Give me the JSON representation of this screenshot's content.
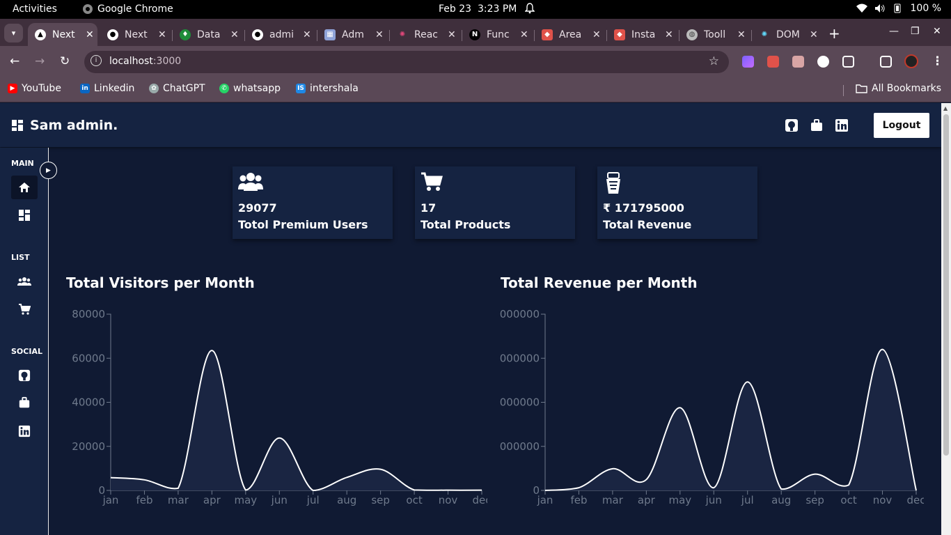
{
  "system": {
    "activities": "Activities",
    "app_name": "Google Chrome",
    "date": "Feb 23",
    "time": "3:23 PM",
    "battery": "100 %"
  },
  "browser": {
    "tabs": [
      {
        "label": "Next",
        "icon": "nextjs-icon",
        "active": true
      },
      {
        "label": "Next",
        "icon": "github-icon"
      },
      {
        "label": "Data",
        "icon": "mongodb-icon"
      },
      {
        "label": "admi",
        "icon": "github-icon"
      },
      {
        "label": "Adm",
        "icon": "dashboard-icon"
      },
      {
        "label": "Reac",
        "icon": "react-icon"
      },
      {
        "label": "Func",
        "icon": "nextjs-icon"
      },
      {
        "label": "Area",
        "icon": "box-icon"
      },
      {
        "label": "Insta",
        "icon": "box-icon"
      },
      {
        "label": "Tooll",
        "icon": "globe-icon"
      },
      {
        "label": "DOM",
        "icon": "react-icon"
      }
    ],
    "url_host": "localhost",
    "url_port": ":3000",
    "bookmarks": [
      {
        "label": "YouTube"
      },
      {
        "label": "Linkedin"
      },
      {
        "label": "ChatGPT"
      },
      {
        "label": "whatsapp"
      },
      {
        "label": "intershala"
      }
    ],
    "all_bookmarks": "All Bookmarks"
  },
  "app": {
    "brand": "Sam admin.",
    "logout": "Logout",
    "sidebar": {
      "main_title": "MAIN",
      "list_title": "LIST",
      "social_title": "SOCIAL"
    },
    "cards": [
      {
        "value": "29077",
        "label": "Totol Premium Users",
        "icon": "users-icon"
      },
      {
        "value": "17",
        "label": "Total Products",
        "icon": "cart-icon"
      },
      {
        "value": "₹ 171795000",
        "label": "Total Revenue",
        "icon": "money-icon"
      }
    ]
  },
  "chart_data": [
    {
      "type": "line",
      "title": "Total Visitors per Month",
      "categories": [
        "jan",
        "feb",
        "mar",
        "apr",
        "may",
        "jun",
        "jul",
        "aug",
        "sep",
        "oct",
        "nov",
        "dec"
      ],
      "values": [
        5800,
        4800,
        1000,
        63500,
        200,
        23800,
        0,
        5900,
        9600,
        200,
        100,
        100
      ],
      "yticks": [
        "0",
        "20000",
        "40000",
        "60000",
        "80000"
      ],
      "ylim": [
        0,
        80000
      ],
      "color": "#ffffff"
    },
    {
      "type": "line",
      "title": "Total Revenue per Month",
      "categories": [
        "jan",
        "feb",
        "mar",
        "apr",
        "may",
        "jun",
        "jul",
        "aug",
        "sep",
        "oct",
        "nov",
        "dec"
      ],
      "values": [
        0,
        2000000,
        16000000,
        8000000,
        61000000,
        2000000,
        80000000,
        1000000,
        12000000,
        4000000,
        104000000,
        0
      ],
      "yticks": [
        "0",
        "000000",
        "000000",
        "000000",
        "000000"
      ],
      "ylim": [
        0,
        130000000
      ],
      "color": "#ffffff"
    }
  ]
}
